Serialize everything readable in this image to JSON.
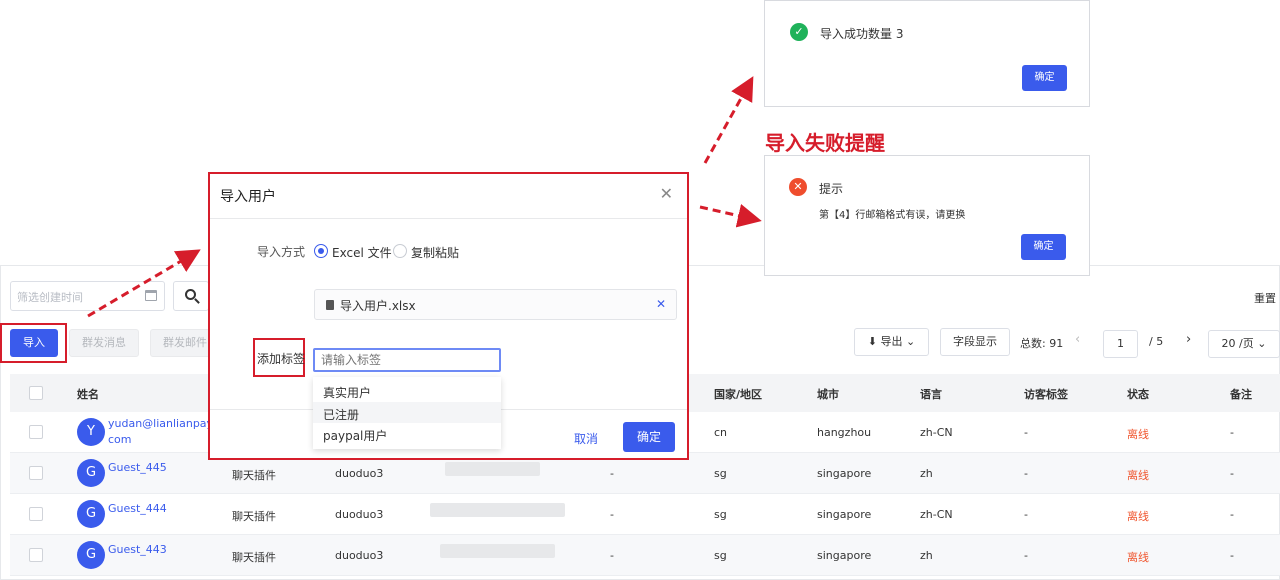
{
  "toolbar": {
    "date_placeholder": "筛选创建时间",
    "reset": "重置",
    "import": "导入",
    "broadcast_msg": "群发消息",
    "broadcast_mail": "群发邮件",
    "export": "导出",
    "fields": "字段显示",
    "total": "总数: 91",
    "page": "1",
    "pages": "/ 5",
    "page_size": "20 /页"
  },
  "table": {
    "headers": {
      "name": "姓名",
      "country": "国家/地区",
      "city": "城市",
      "lang": "语言",
      "visitor_tag": "访客标签",
      "status": "状态",
      "remark": "备注"
    },
    "rows": [
      {
        "avatar": "Y",
        "name": "yudan@lianlianpay.",
        "name2": "com",
        "source": "",
        "user": "",
        "dash": "",
        "country": "cn",
        "city": "hangzhou",
        "lang": "zh-CN",
        "tag": "-",
        "status": "离线",
        "remark": "-"
      },
      {
        "avatar": "G",
        "name": "Guest_445",
        "name2": "",
        "source": "聊天插件",
        "user": "duoduo3",
        "dash": "-",
        "country": "sg",
        "city": "singapore",
        "lang": "zh",
        "tag": "-",
        "status": "离线",
        "remark": "-"
      },
      {
        "avatar": "G",
        "name": "Guest_444",
        "name2": "",
        "source": "聊天插件",
        "user": "duoduo3",
        "dash": "-",
        "country": "sg",
        "city": "singapore",
        "lang": "zh-CN",
        "tag": "-",
        "status": "离线",
        "remark": "-"
      },
      {
        "avatar": "G",
        "name": "Guest_443",
        "name2": "",
        "source": "聊天插件",
        "user": "duoduo3",
        "dash": "-",
        "country": "sg",
        "city": "singapore",
        "lang": "zh",
        "tag": "-",
        "status": "离线",
        "remark": "-"
      }
    ]
  },
  "modal": {
    "title": "导入用户",
    "method_label": "导入方式",
    "opt_excel": "Excel 文件",
    "opt_paste": "复制粘贴",
    "file_name": "导入用户.xlsx",
    "tag_label": "添加标签",
    "tag_placeholder": "请输入标签",
    "tag_options": [
      "真实用户",
      "已注册",
      "paypal用户"
    ],
    "cancel": "取消",
    "confirm": "确定"
  },
  "success_dialog": {
    "message": "导入成功数量 3",
    "confirm": "确定"
  },
  "fail_caption": "导入失败提醒",
  "fail_dialog": {
    "title": "提示",
    "message": "第【4】行邮箱格式有误，请更换",
    "confirm": "确定"
  },
  "colors": {
    "primary": "#3a5bec",
    "highlight_red": "#d61d2b",
    "offline": "#f0562f",
    "success": "#1fb25a",
    "error": "#ef4d2d"
  }
}
